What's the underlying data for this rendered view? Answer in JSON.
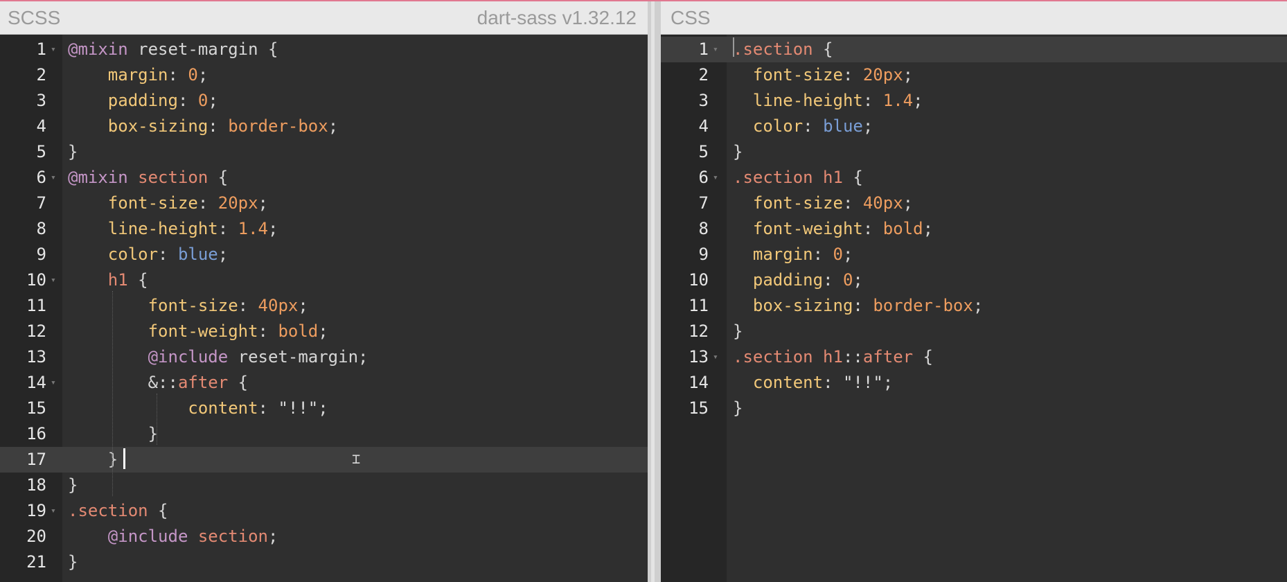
{
  "left": {
    "title": "SCSS",
    "version": "dart-sass v1.32.12",
    "active_line": 17,
    "lines": [
      {
        "n": "1",
        "fold": true,
        "indent": "",
        "tokens": [
          {
            "t": "@mixin",
            "c": "at"
          },
          {
            "t": " reset-margin {",
            "c": "pun"
          }
        ]
      },
      {
        "n": "2",
        "fold": false,
        "indent": "    ",
        "tokens": [
          {
            "t": "margin",
            "c": "prop"
          },
          {
            "t": ": ",
            "c": "pun"
          },
          {
            "t": "0",
            "c": "num"
          },
          {
            "t": ";",
            "c": "pun"
          }
        ]
      },
      {
        "n": "3",
        "fold": false,
        "indent": "    ",
        "tokens": [
          {
            "t": "padding",
            "c": "prop"
          },
          {
            "t": ": ",
            "c": "pun"
          },
          {
            "t": "0",
            "c": "num"
          },
          {
            "t": ";",
            "c": "pun"
          }
        ]
      },
      {
        "n": "4",
        "fold": false,
        "indent": "    ",
        "tokens": [
          {
            "t": "box-sizing",
            "c": "prop"
          },
          {
            "t": ": ",
            "c": "pun"
          },
          {
            "t": "border-box",
            "c": "val"
          },
          {
            "t": ";",
            "c": "pun"
          }
        ]
      },
      {
        "n": "5",
        "fold": false,
        "indent": "",
        "tokens": [
          {
            "t": "}",
            "c": "pun"
          }
        ]
      },
      {
        "n": "6",
        "fold": true,
        "indent": "",
        "tokens": [
          {
            "t": "@mixin",
            "c": "at"
          },
          {
            "t": " ",
            "c": "pun"
          },
          {
            "t": "section",
            "c": "sel"
          },
          {
            "t": " {",
            "c": "pun"
          }
        ]
      },
      {
        "n": "7",
        "fold": false,
        "indent": "    ",
        "tokens": [
          {
            "t": "font-size",
            "c": "prop"
          },
          {
            "t": ": ",
            "c": "pun"
          },
          {
            "t": "20px",
            "c": "num"
          },
          {
            "t": ";",
            "c": "pun"
          }
        ]
      },
      {
        "n": "8",
        "fold": false,
        "indent": "    ",
        "tokens": [
          {
            "t": "line-height",
            "c": "prop"
          },
          {
            "t": ": ",
            "c": "pun"
          },
          {
            "t": "1.4",
            "c": "num"
          },
          {
            "t": ";",
            "c": "pun"
          }
        ]
      },
      {
        "n": "9",
        "fold": false,
        "indent": "    ",
        "tokens": [
          {
            "t": "color",
            "c": "prop"
          },
          {
            "t": ": ",
            "c": "pun"
          },
          {
            "t": "blue",
            "c": "kw"
          },
          {
            "t": ";",
            "c": "pun"
          }
        ]
      },
      {
        "n": "10",
        "fold": true,
        "indent": "    ",
        "tokens": [
          {
            "t": "h1",
            "c": "sel"
          },
          {
            "t": " {",
            "c": "pun"
          }
        ]
      },
      {
        "n": "11",
        "fold": false,
        "indent": "        ",
        "tokens": [
          {
            "t": "font-size",
            "c": "prop"
          },
          {
            "t": ": ",
            "c": "pun"
          },
          {
            "t": "40px",
            "c": "num"
          },
          {
            "t": ";",
            "c": "pun"
          }
        ]
      },
      {
        "n": "12",
        "fold": false,
        "indent": "        ",
        "tokens": [
          {
            "t": "font-weight",
            "c": "prop"
          },
          {
            "t": ": ",
            "c": "pun"
          },
          {
            "t": "bold",
            "c": "val"
          },
          {
            "t": ";",
            "c": "pun"
          }
        ]
      },
      {
        "n": "13",
        "fold": false,
        "indent": "        ",
        "tokens": [
          {
            "t": "@include",
            "c": "at"
          },
          {
            "t": " reset-margin;",
            "c": "pun"
          }
        ]
      },
      {
        "n": "14",
        "fold": true,
        "indent": "        ",
        "tokens": [
          {
            "t": "&::",
            "c": "pun"
          },
          {
            "t": "after",
            "c": "sel"
          },
          {
            "t": " {",
            "c": "pun"
          }
        ]
      },
      {
        "n": "15",
        "fold": false,
        "indent": "            ",
        "tokens": [
          {
            "t": "content",
            "c": "prop"
          },
          {
            "t": ": ",
            "c": "pun"
          },
          {
            "t": "\"!!\"",
            "c": "str"
          },
          {
            "t": ";",
            "c": "pun"
          }
        ]
      },
      {
        "n": "16",
        "fold": false,
        "indent": "        ",
        "tokens": [
          {
            "t": "}",
            "c": "pun"
          }
        ]
      },
      {
        "n": "17",
        "fold": false,
        "indent": "    ",
        "tokens": [
          {
            "t": "}",
            "c": "pun"
          }
        ]
      },
      {
        "n": "18",
        "fold": false,
        "indent": "",
        "tokens": [
          {
            "t": "}",
            "c": "pun"
          }
        ]
      },
      {
        "n": "19",
        "fold": true,
        "indent": "",
        "tokens": [
          {
            "t": ".section",
            "c": "sel"
          },
          {
            "t": " {",
            "c": "pun"
          }
        ]
      },
      {
        "n": "20",
        "fold": false,
        "indent": "    ",
        "tokens": [
          {
            "t": "@include",
            "c": "at"
          },
          {
            "t": " ",
            "c": "pun"
          },
          {
            "t": "section",
            "c": "sel"
          },
          {
            "t": ";",
            "c": "pun"
          }
        ]
      },
      {
        "n": "21",
        "fold": false,
        "indent": "",
        "tokens": [
          {
            "t": "}",
            "c": "pun"
          }
        ]
      }
    ]
  },
  "right": {
    "title": "CSS",
    "active_line": 1,
    "lines": [
      {
        "n": "1",
        "fold": true,
        "indent": "",
        "tokens": [
          {
            "t": ".section",
            "c": "sel"
          },
          {
            "t": " {",
            "c": "pun"
          }
        ]
      },
      {
        "n": "2",
        "fold": false,
        "indent": "  ",
        "tokens": [
          {
            "t": "font-size",
            "c": "prop"
          },
          {
            "t": ": ",
            "c": "pun"
          },
          {
            "t": "20px",
            "c": "num"
          },
          {
            "t": ";",
            "c": "pun"
          }
        ]
      },
      {
        "n": "3",
        "fold": false,
        "indent": "  ",
        "tokens": [
          {
            "t": "line-height",
            "c": "prop"
          },
          {
            "t": ": ",
            "c": "pun"
          },
          {
            "t": "1.4",
            "c": "num"
          },
          {
            "t": ";",
            "c": "pun"
          }
        ]
      },
      {
        "n": "4",
        "fold": false,
        "indent": "  ",
        "tokens": [
          {
            "t": "color",
            "c": "prop"
          },
          {
            "t": ": ",
            "c": "pun"
          },
          {
            "t": "blue",
            "c": "kw"
          },
          {
            "t": ";",
            "c": "pun"
          }
        ]
      },
      {
        "n": "5",
        "fold": false,
        "indent": "",
        "tokens": [
          {
            "t": "}",
            "c": "pun"
          }
        ]
      },
      {
        "n": "6",
        "fold": true,
        "indent": "",
        "tokens": [
          {
            "t": ".section",
            "c": "sel"
          },
          {
            "t": " ",
            "c": "pun"
          },
          {
            "t": "h1",
            "c": "sel"
          },
          {
            "t": " {",
            "c": "pun"
          }
        ]
      },
      {
        "n": "7",
        "fold": false,
        "indent": "  ",
        "tokens": [
          {
            "t": "font-size",
            "c": "prop"
          },
          {
            "t": ": ",
            "c": "pun"
          },
          {
            "t": "40px",
            "c": "num"
          },
          {
            "t": ";",
            "c": "pun"
          }
        ]
      },
      {
        "n": "8",
        "fold": false,
        "indent": "  ",
        "tokens": [
          {
            "t": "font-weight",
            "c": "prop"
          },
          {
            "t": ": ",
            "c": "pun"
          },
          {
            "t": "bold",
            "c": "val"
          },
          {
            "t": ";",
            "c": "pun"
          }
        ]
      },
      {
        "n": "9",
        "fold": false,
        "indent": "  ",
        "tokens": [
          {
            "t": "margin",
            "c": "prop"
          },
          {
            "t": ": ",
            "c": "pun"
          },
          {
            "t": "0",
            "c": "num"
          },
          {
            "t": ";",
            "c": "pun"
          }
        ]
      },
      {
        "n": "10",
        "fold": false,
        "indent": "  ",
        "tokens": [
          {
            "t": "padding",
            "c": "prop"
          },
          {
            "t": ": ",
            "c": "pun"
          },
          {
            "t": "0",
            "c": "num"
          },
          {
            "t": ";",
            "c": "pun"
          }
        ]
      },
      {
        "n": "11",
        "fold": false,
        "indent": "  ",
        "tokens": [
          {
            "t": "box-sizing",
            "c": "prop"
          },
          {
            "t": ": ",
            "c": "pun"
          },
          {
            "t": "border-box",
            "c": "val"
          },
          {
            "t": ";",
            "c": "pun"
          }
        ]
      },
      {
        "n": "12",
        "fold": false,
        "indent": "",
        "tokens": [
          {
            "t": "}",
            "c": "pun"
          }
        ]
      },
      {
        "n": "13",
        "fold": true,
        "indent": "",
        "tokens": [
          {
            "t": ".section",
            "c": "sel"
          },
          {
            "t": " ",
            "c": "pun"
          },
          {
            "t": "h1",
            "c": "sel"
          },
          {
            "t": "::",
            "c": "pun"
          },
          {
            "t": "after",
            "c": "sel"
          },
          {
            "t": " {",
            "c": "pun"
          }
        ]
      },
      {
        "n": "14",
        "fold": false,
        "indent": "  ",
        "tokens": [
          {
            "t": "content",
            "c": "prop"
          },
          {
            "t": ": ",
            "c": "pun"
          },
          {
            "t": "\"!!\"",
            "c": "str"
          },
          {
            "t": ";",
            "c": "pun"
          }
        ]
      },
      {
        "n": "15",
        "fold": false,
        "indent": "",
        "tokens": [
          {
            "t": "}",
            "c": "pun"
          }
        ]
      }
    ]
  },
  "colors": {
    "at": "#c596c7",
    "selector": "#e48a73",
    "property": "#f2c879",
    "number": "#ee9d5f",
    "keyword": "#7a9ed6",
    "editor_bg": "#2f2f2f",
    "gutter_bg": "#262626",
    "header_bg": "#e9e9e9"
  }
}
